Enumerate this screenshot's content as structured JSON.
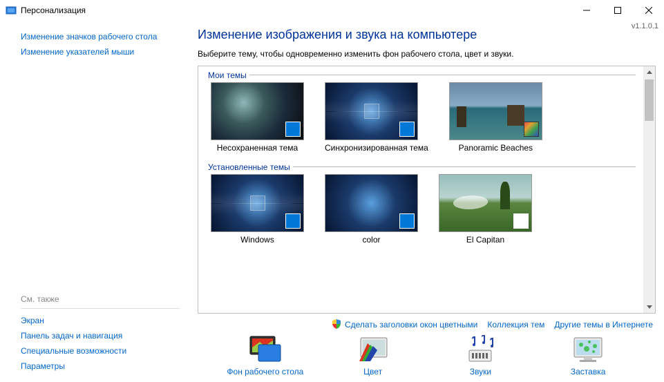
{
  "window": {
    "title": "Персонализация",
    "version": "v1.1.0.1"
  },
  "sidebar": {
    "top": [
      "Изменение значков рабочего стола",
      "Изменение указателей мыши"
    ],
    "see_also_heading": "См. также",
    "bottom": [
      "Экран",
      "Панель задач и навигация",
      "Специальные возможности",
      "Параметры"
    ]
  },
  "main": {
    "title": "Изменение изображения и звука на компьютере",
    "subtitle": "Выберите тему, чтобы одновременно изменить фон рабочего стола, цвет и звуки.",
    "group_my": "Мои темы",
    "group_installed": "Установленные темы",
    "themes_my": [
      {
        "name": "Несохраненная тема"
      },
      {
        "name": "Синхронизированная тема"
      },
      {
        "name": "Panoramic Beaches"
      }
    ],
    "themes_installed": [
      {
        "name": "Windows"
      },
      {
        "name": "color"
      },
      {
        "name": "El Capitan"
      }
    ],
    "links": {
      "colored_titles": "Сделать заголовки окон цветными",
      "collection": "Коллекция тем",
      "online": "Другие темы в Интернете"
    },
    "bottom": {
      "desktop_bg": "Фон рабочего стола",
      "color": "Цвет",
      "sounds": "Звуки",
      "screensaver": "Заставка"
    }
  }
}
